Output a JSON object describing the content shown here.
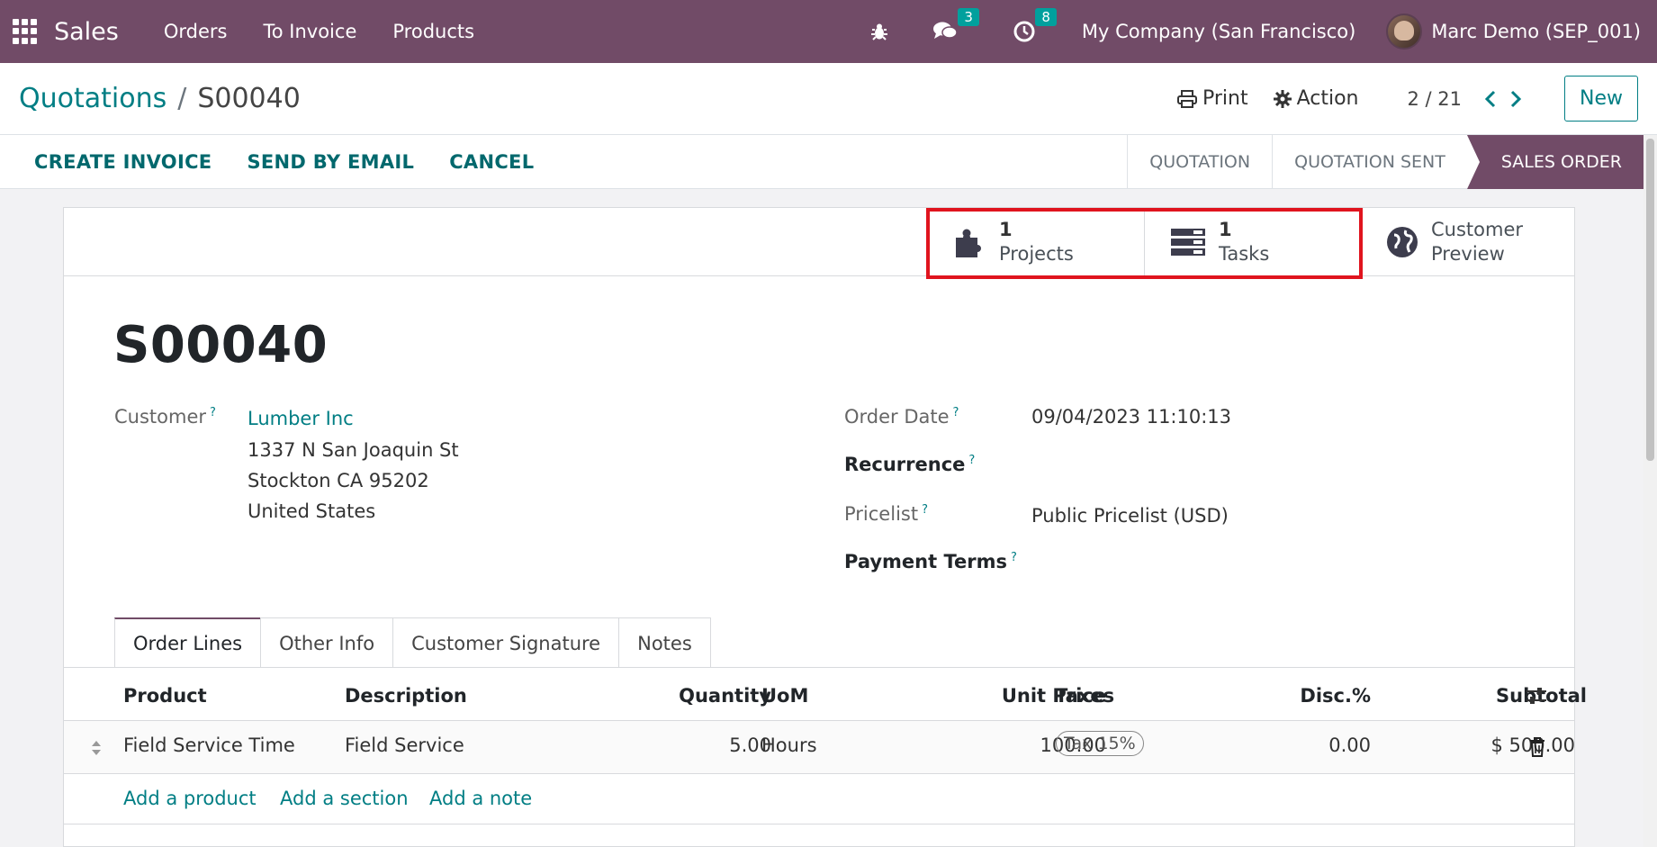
{
  "navbar": {
    "brand": "Sales",
    "menu": [
      {
        "label": "Orders"
      },
      {
        "label": "To Invoice"
      },
      {
        "label": "Products"
      }
    ],
    "messages_count": "3",
    "activities_count": "8",
    "company": "My Company (San Francisco)",
    "user": "Marc Demo (SEP_001)",
    "icons": {
      "apps": "grid-icon",
      "debug": "bug-icon",
      "messages": "chat-icon",
      "activities": "clock-icon"
    }
  },
  "control": {
    "breadcrumb_parent": "Quotations",
    "breadcrumb_sep": "/",
    "breadcrumb_current": "S00040",
    "print_label": "Print",
    "action_label": "Action",
    "pager": "2 / 21",
    "new_label": "New"
  },
  "statusbar": {
    "actions": [
      {
        "label": "CREATE INVOICE"
      },
      {
        "label": "SEND BY EMAIL"
      },
      {
        "label": "CANCEL"
      }
    ],
    "stages": [
      {
        "label": "QUOTATION"
      },
      {
        "label": "QUOTATION SENT"
      },
      {
        "label": "SALES ORDER",
        "active": true
      }
    ]
  },
  "smart_buttons": {
    "projects": {
      "value": "1",
      "label": "Projects"
    },
    "tasks": {
      "value": "1",
      "label": "Tasks"
    },
    "preview": {
      "line1": "Customer",
      "line2": "Preview"
    }
  },
  "form": {
    "title": "S00040",
    "customer_label": "Customer",
    "customer_name": "Lumber Inc",
    "address": [
      "1337 N San Joaquin St",
      "Stockton CA 95202",
      "United States"
    ],
    "order_date_label": "Order Date",
    "order_date": "09/04/2023 11:10:13",
    "recurrence_label": "Recurrence",
    "pricelist_label": "Pricelist",
    "pricelist": "Public Pricelist (USD)",
    "payment_terms_label": "Payment Terms",
    "help_mark": "?"
  },
  "tabs": [
    {
      "label": "Order Lines",
      "active": true
    },
    {
      "label": "Other Info"
    },
    {
      "label": "Customer Signature"
    },
    {
      "label": "Notes"
    }
  ],
  "order_lines": {
    "headers": {
      "product": "Product",
      "description": "Description",
      "quantity": "Quantity",
      "uom": "UoM",
      "unit_price": "Unit Price",
      "taxes": "Taxes",
      "discount": "Disc.%",
      "subtotal": "Subtotal"
    },
    "rows": [
      {
        "product": "Field Service Time",
        "description": "Field Service",
        "quantity": "5.00",
        "uom": "Hours",
        "unit_price": "100.00",
        "taxes": "Tax 15%",
        "discount": "0.00",
        "subtotal": "$ 500.00"
      }
    ],
    "add_product": "Add a product",
    "add_section": "Add a section",
    "add_note": "Add a note"
  },
  "colors": {
    "brand": "#714b67",
    "link": "#017e84",
    "badge": "#00a09d",
    "highlight": "#e0141e"
  }
}
